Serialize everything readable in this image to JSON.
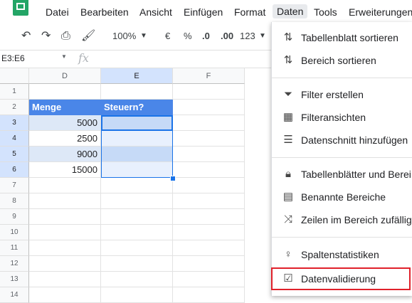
{
  "menubar": {
    "items": [
      "Datei",
      "Bearbeiten",
      "Ansicht",
      "Einfügen",
      "Format",
      "Daten",
      "Tools",
      "Erweiterungen"
    ],
    "active": "Daten"
  },
  "toolbar": {
    "zoom": "100%",
    "currency": "€",
    "percent": "%",
    "decimal_decrease": ".0",
    "decimal_increase": ".00",
    "more_formats": "123"
  },
  "formula_bar": {
    "name_box": "E3:E6",
    "fx": "fx"
  },
  "columns": [
    "D",
    "E",
    "F"
  ],
  "rows": [
    "1",
    "2",
    "3",
    "4",
    "5",
    "6",
    "7",
    "8",
    "9",
    "10",
    "11",
    "12",
    "13",
    "14"
  ],
  "table": {
    "header": [
      "Menge",
      "Steuern?"
    ],
    "values": [
      "5000",
      "2500",
      "9000",
      "15000"
    ]
  },
  "colors": {
    "header_fill": "#4a86e8",
    "selection": "#1a73e8",
    "highlight_box": "#e0212b"
  },
  "data_menu": {
    "items": [
      {
        "icon": "sort-icon",
        "label": "Tabellenblatt sortieren"
      },
      {
        "icon": "sort-icon",
        "label": "Bereich sortieren"
      },
      {
        "icon": "filter-icon",
        "label": "Filter erstellen"
      },
      {
        "icon": "filter-views-icon",
        "label": "Filteransichten"
      },
      {
        "icon": "slicer-icon",
        "label": "Datenschnitt hinzufügen"
      },
      {
        "icon": "lock-icon",
        "label": "Tabellenblätter und Berei"
      },
      {
        "icon": "named-ranges-icon",
        "label": "Benannte Bereiche"
      },
      {
        "icon": "shuffle-icon",
        "label": "Zeilen im Bereich zufällig"
      },
      {
        "icon": "lightbulb-icon",
        "label": "Spaltenstatistiken"
      },
      {
        "icon": "data-validation-icon",
        "label": "Datenvalidierung"
      }
    ]
  }
}
